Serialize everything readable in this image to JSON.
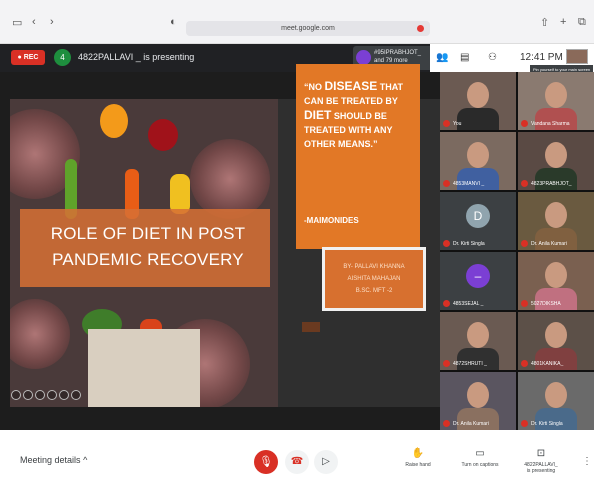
{
  "browser": {
    "url": "meet.google.com",
    "icons": {
      "sidebar": "sidebar-icon",
      "back": "back-icon",
      "forward": "forward-icon",
      "shield": "shield-icon",
      "share": "share-icon",
      "new_tab": "new-tab-icon",
      "tabs": "tabs-icon"
    }
  },
  "meeting": {
    "rec_label": "REC",
    "presenter_initial": "4",
    "presenting_text": "4822PALLAVI _ is presenting",
    "pinned_name": "#95IPRABHJOT_",
    "pinned_more": "and 79 more",
    "time": "12:41 PM",
    "tooltip": "Pin yourself to your main screen"
  },
  "slide": {
    "title": "ROLE OF DIET IN POST PANDEMIC RECOVERY",
    "quote_parts": [
      "“NO ",
      "DISEASE",
      " THAT CAN BE TREATED BY ",
      "DIET",
      " SHOULD BE TREATED WITH ANY OTHER MEANS.”"
    ],
    "quote_author": "-MAIMONIDES",
    "credits": [
      "BY- PALLAVI KHANNA",
      "AISHITA MAHAJAN",
      "B.SC. MFT -2"
    ]
  },
  "participants": [
    {
      "name": "You",
      "col": 0,
      "row": 0
    },
    {
      "name": "Vandana Sharma",
      "col": 1,
      "row": 0
    },
    {
      "name": "4853MANVI _",
      "col": 0,
      "row": 1
    },
    {
      "name": "4823PRABHJOT_",
      "col": 1,
      "row": 1
    },
    {
      "name": "Dr. Kirti Singla",
      "col": 0,
      "row": 2,
      "avatar_letter": "D",
      "avatar_color": "#90a4ae"
    },
    {
      "name": "Dr. Anila Kumari",
      "col": 1,
      "row": 2
    },
    {
      "name": "4853SEJAL _",
      "col": 0,
      "row": 3,
      "avatar_letter": "–",
      "avatar_color": "#7b3fd4"
    },
    {
      "name": "5027DIKSHA",
      "col": 1,
      "row": 3
    },
    {
      "name": "4872SHRUTI _",
      "col": 0,
      "row": 4
    },
    {
      "name": "4801KANIKA_",
      "col": 1,
      "row": 4
    },
    {
      "name": "Dr. Anila Kumari",
      "col": 0,
      "row": 5
    },
    {
      "name": "Dr. Kirti Singla",
      "col": 1,
      "row": 5
    }
  ],
  "bottom": {
    "meeting_details": "Meeting details",
    "raise_hand": "Raise hand",
    "captions": "Turn on captions",
    "presenting_name": "4822PALLAVI_",
    "presenting_state": "is presenting"
  },
  "colors": {
    "accent_orange": "#e27826",
    "rec_red": "#d93025",
    "meet_dark": "#202124"
  }
}
